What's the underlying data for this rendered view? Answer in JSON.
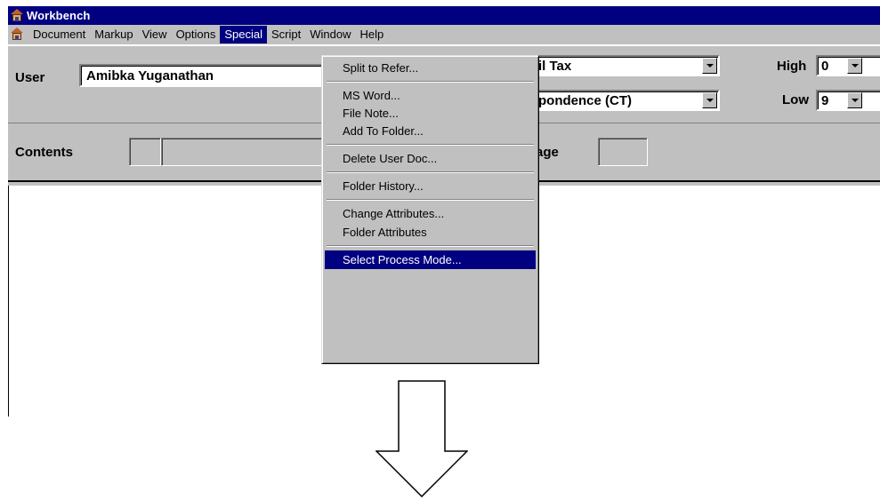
{
  "window": {
    "title": "Workbench"
  },
  "menubar": {
    "items": [
      "Document",
      "Markup",
      "View",
      "Options",
      "Special",
      "Script",
      "Window",
      "Help"
    ],
    "active": "Special"
  },
  "toolbar": {
    "user_label": "User",
    "user_value": "Amibka Yuganathan",
    "combo1_value": "il Tax",
    "combo2_value": "pondence (CT)",
    "high_label": "High",
    "high_value": "0",
    "low_label": "Low",
    "low_value": "9"
  },
  "contents": {
    "label": "Contents",
    "page_label": "age"
  },
  "special_menu": {
    "items": [
      {
        "label": "Split to Refer..."
      },
      {
        "label": "MS Word..."
      },
      {
        "label": "File Note..."
      },
      {
        "label": "Add To Folder..."
      },
      {
        "label": "Delete User Doc..."
      },
      {
        "label": "Folder History..."
      },
      {
        "label": "Change Attributes..."
      },
      {
        "label": "Folder Attributes"
      },
      {
        "label": "Select Process Mode..."
      }
    ],
    "highlighted": "Select Process Mode..."
  },
  "icons": {
    "app": "workbench-app-icon",
    "dropdown": "dropdown-arrow-icon",
    "annotation": "down-arrow-icon"
  },
  "colors": {
    "titlebar": "#000080",
    "face": "#c0c0c0",
    "highlight": "#000080"
  }
}
